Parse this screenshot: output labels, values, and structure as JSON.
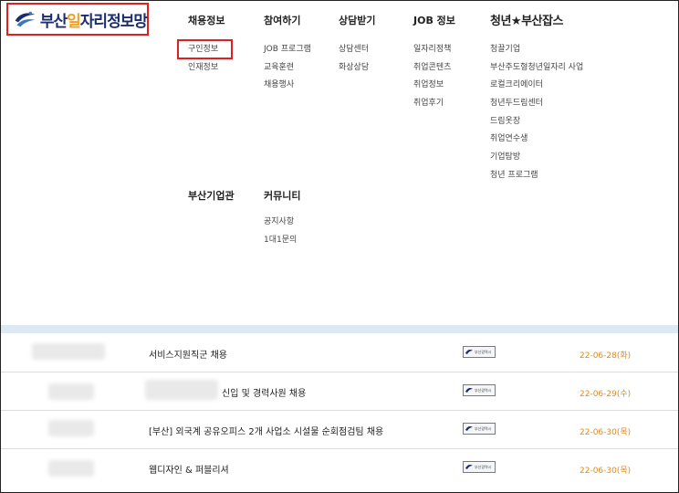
{
  "header": {
    "logo": {
      "part1": "부산",
      "accent": "일",
      "part2": "자리정보망"
    }
  },
  "nav": {
    "columns": [
      {
        "head": "채용정보",
        "items": [
          "구인정보",
          "인재정보"
        ]
      },
      {
        "head": "참여하기",
        "items": [
          "JOB 프로그램",
          "교육훈련",
          "채용행사"
        ]
      },
      {
        "head": "상담받기",
        "items": [
          "상담센터",
          "화상상담"
        ]
      },
      {
        "head": "JOB 정보",
        "items": [
          "일자리정책",
          "취업콘텐츠",
          "취업정보",
          "취업후기"
        ]
      },
      {
        "head": "청년★부산잡스",
        "items": [
          "청끌기업",
          "부산주도형청년일자리 사업",
          "로컬크리에이터",
          "청년두드림센터",
          "드림옷장",
          "취업연수생",
          "기업탐방",
          "청년 프로그램"
        ]
      },
      {
        "head": "부산기업관",
        "items": []
      },
      {
        "head": "커뮤니티",
        "items": [
          "공지사항",
          "1대1문의"
        ]
      }
    ],
    "highlighted_item": "구인정보"
  },
  "jobs": {
    "badge_label": "부산광역시",
    "rows": [
      {
        "title": "서비스지원직군 채용",
        "date": "22-06-28(화)"
      },
      {
        "title": "신입 및 경력사원 채용",
        "date": "22-06-29(수)"
      },
      {
        "title": "[부산] 외국계 공유오피스 2개 사업소 시설물 순회점검팀 채용",
        "date": "22-06-30(목)"
      },
      {
        "title": "웹디자인 & 퍼블리셔",
        "date": "22-06-30(목)"
      }
    ]
  },
  "colors": {
    "brand_navy": "#1b2d6e",
    "brand_orange": "#f0a020",
    "highlight_red": "#e02020",
    "date_orange": "#e08a1e",
    "band_blue": "#dce9f5"
  }
}
